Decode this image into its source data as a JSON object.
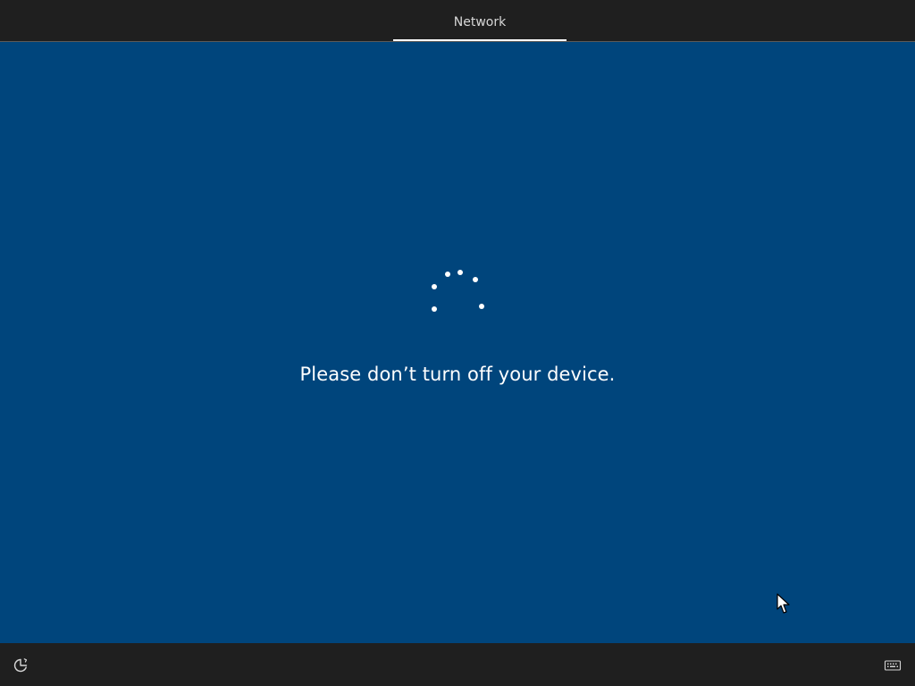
{
  "header": {
    "tabs": [
      {
        "label": "Network",
        "active": true
      }
    ]
  },
  "main": {
    "status_message": "Please don’t turn off your device.",
    "spinner": {
      "type": "dots",
      "count": 6
    }
  },
  "footer": {
    "left_icon": "ease-of-access-icon",
    "right_icon": "keyboard-icon"
  },
  "colors": {
    "chrome": "#1f1f1f",
    "background": "#00457c",
    "text": "#ffffff",
    "accent": "#ffffff"
  }
}
